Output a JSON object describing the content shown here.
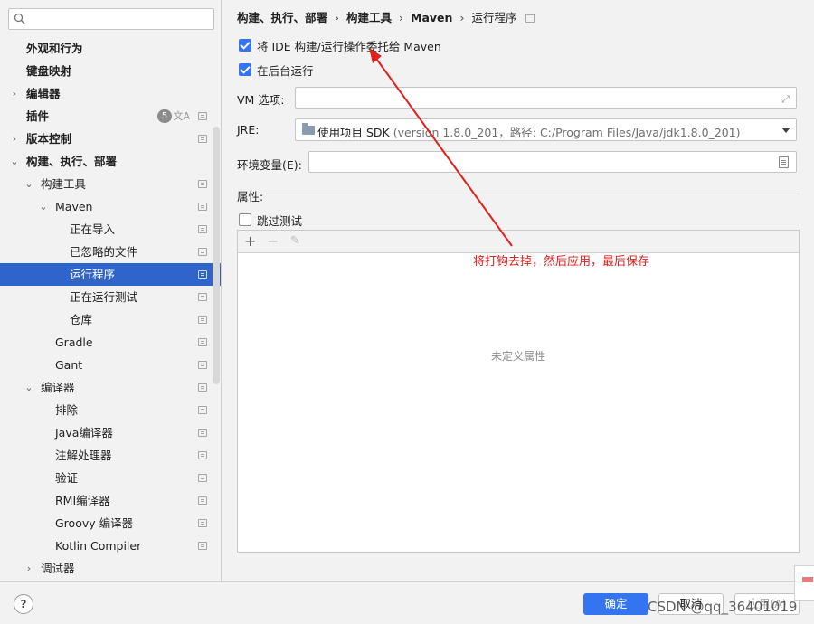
{
  "search": {
    "value": ""
  },
  "sidebar": {
    "badge_count": "5",
    "items": [
      {
        "label": "外观和行为",
        "level": 0,
        "arrow": "",
        "bold": true,
        "page_icon": false
      },
      {
        "label": "键盘映射",
        "level": 0,
        "arrow": "",
        "bold": true,
        "page_icon": false
      },
      {
        "label": "编辑器",
        "level": 0,
        "arrow": "›",
        "bold": true,
        "page_icon": false
      },
      {
        "label": "插件",
        "level": 0,
        "arrow": "",
        "bold": true,
        "page_icon": true,
        "badge": true
      },
      {
        "label": "版本控制",
        "level": 0,
        "arrow": "›",
        "bold": true,
        "page_icon": true
      },
      {
        "label": "构建、执行、部署",
        "level": 0,
        "arrow": "⌄",
        "bold": true,
        "page_icon": false
      },
      {
        "label": "构建工具",
        "level": 1,
        "arrow": "⌄",
        "bold": false,
        "page_icon": true
      },
      {
        "label": "Maven",
        "level": 2,
        "arrow": "⌄",
        "bold": false,
        "page_icon": true
      },
      {
        "label": "正在导入",
        "level": 3,
        "arrow": "",
        "bold": false,
        "page_icon": true
      },
      {
        "label": "已忽略的文件",
        "level": 3,
        "arrow": "",
        "bold": false,
        "page_icon": true
      },
      {
        "label": "运行程序",
        "level": 3,
        "arrow": "",
        "bold": false,
        "page_icon": true,
        "selected": true
      },
      {
        "label": "正在运行测试",
        "level": 3,
        "arrow": "",
        "bold": false,
        "page_icon": true
      },
      {
        "label": "仓库",
        "level": 3,
        "arrow": "",
        "bold": false,
        "page_icon": true
      },
      {
        "label": "Gradle",
        "level": 2,
        "arrow": "",
        "bold": false,
        "page_icon": true
      },
      {
        "label": "Gant",
        "level": 2,
        "arrow": "",
        "bold": false,
        "page_icon": true
      },
      {
        "label": "编译器",
        "level": 1,
        "arrow": "⌄",
        "bold": false,
        "page_icon": true
      },
      {
        "label": "排除",
        "level": 2,
        "arrow": "",
        "bold": false,
        "page_icon": true
      },
      {
        "label": "Java编译器",
        "level": 2,
        "arrow": "",
        "bold": false,
        "page_icon": true
      },
      {
        "label": "注解处理器",
        "level": 2,
        "arrow": "",
        "bold": false,
        "page_icon": true
      },
      {
        "label": "验证",
        "level": 2,
        "arrow": "",
        "bold": false,
        "page_icon": true
      },
      {
        "label": "RMI编译器",
        "level": 2,
        "arrow": "",
        "bold": false,
        "page_icon": true
      },
      {
        "label": "Groovy 编译器",
        "level": 2,
        "arrow": "",
        "bold": false,
        "page_icon": true
      },
      {
        "label": "Kotlin Compiler",
        "level": 2,
        "arrow": "",
        "bold": false,
        "page_icon": true
      },
      {
        "label": "调试器",
        "level": 1,
        "arrow": "›",
        "bold": false,
        "page_icon": false
      }
    ]
  },
  "breadcrumb": {
    "items": [
      "构建、执行、部署",
      "构建工具",
      "Maven"
    ],
    "leaf": "运行程序",
    "separator": "›"
  },
  "settings": {
    "delegate_label": "将 IDE 构建/运行操作委托给 Maven",
    "delegate_checked": true,
    "background_label": "在后台运行",
    "background_checked": true,
    "vm_label": "VM 选项:",
    "vm_value": "",
    "jre_label": "JRE:",
    "jre_value": "使用项目 SDK",
    "jre_hint": "(version 1.8.0_201，路径: C:/Program Files/Java/jdk1.8.0_201)",
    "env_label": "环境变量(E):",
    "env_value": "",
    "props_label": "属性:",
    "skip_tests_label": "跳过测试",
    "skip_tests_checked": false,
    "empty_props": "未定义属性"
  },
  "annotation": {
    "text": "将打钩去掉，然后应用，最后保存",
    "color": "#e0201c"
  },
  "footer": {
    "help": "?",
    "ok": "确定",
    "cancel": "取消",
    "apply": "应用(A)",
    "watermark": "CSDN @qq_36401019"
  },
  "colors": {
    "accent": "#3574f0",
    "selection": "#2f65ca",
    "annotation": "#e0201c"
  }
}
